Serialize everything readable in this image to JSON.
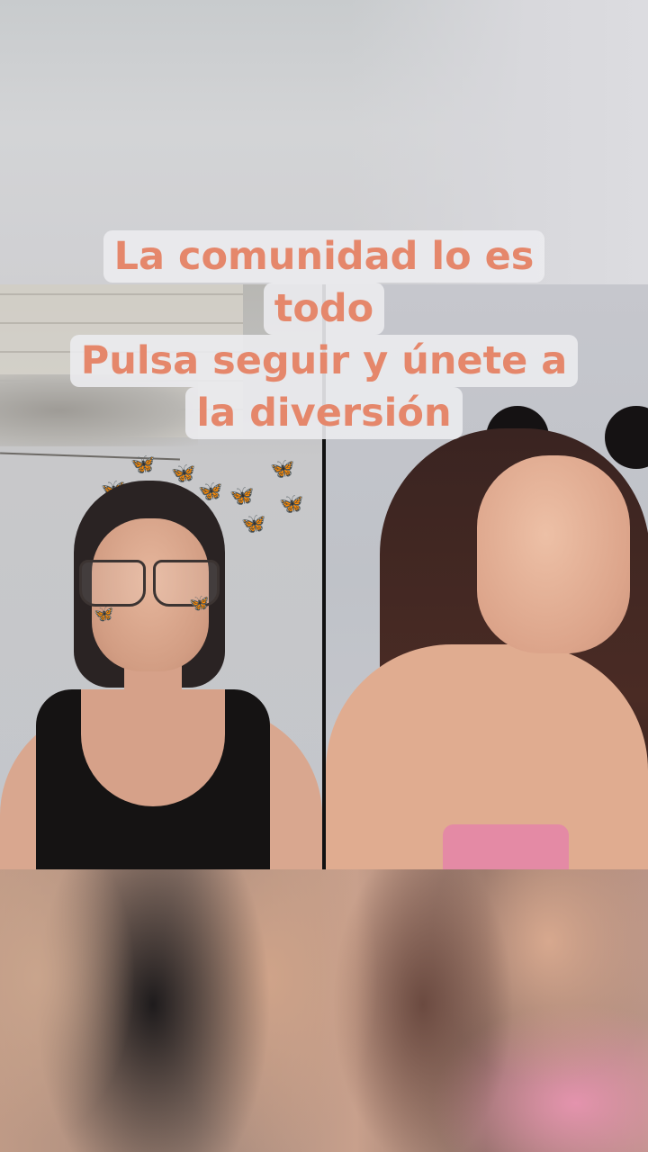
{
  "caption": {
    "lines": [
      "La comunidad lo es",
      "todo",
      "Pulsa seguir y únete a",
      "la diversión"
    ],
    "text_color": "#e5876b",
    "background_color": "#ebebee"
  },
  "call": {
    "layout": "split-screen",
    "participants": [
      {
        "position": "left",
        "description_icon": "person-with-glasses"
      },
      {
        "position": "right",
        "description_icon": "person-with-cat-ears"
      }
    ]
  }
}
